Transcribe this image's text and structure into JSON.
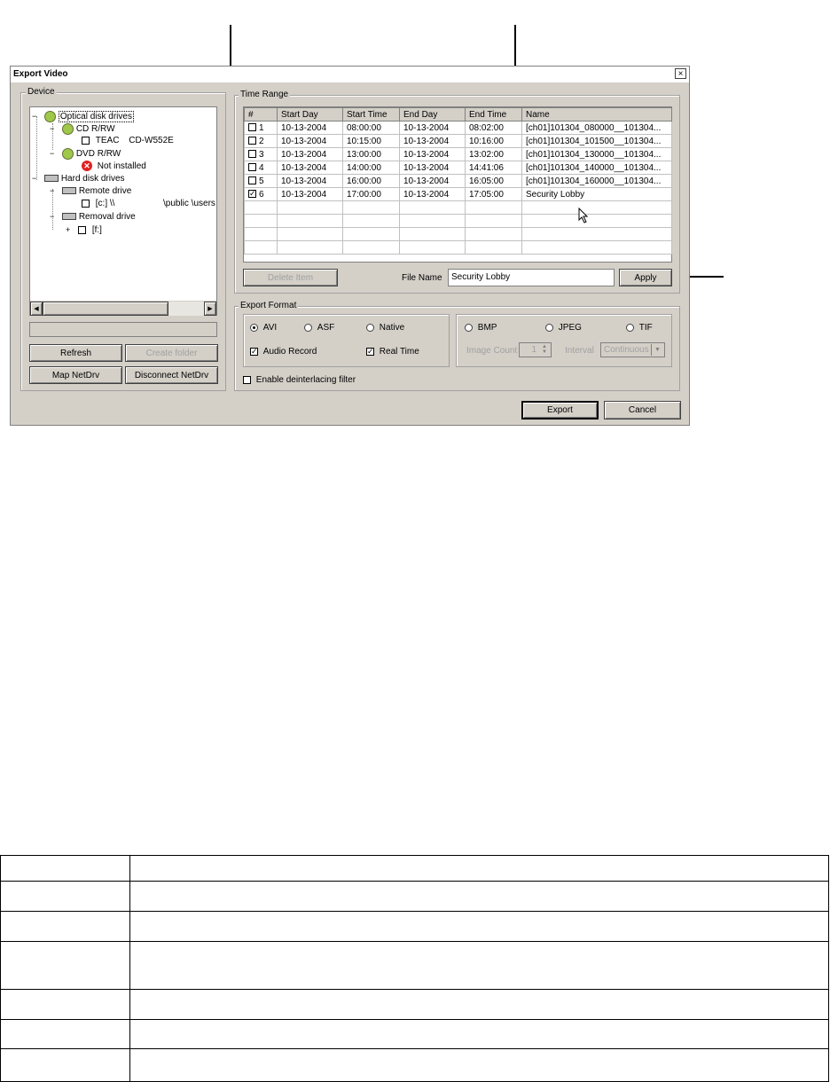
{
  "window": {
    "title": "Export Video",
    "close": "×"
  },
  "device": {
    "group_label": "Device",
    "tree": {
      "optical": "Optical disk drives",
      "cdrw": "CD R/RW",
      "teac": "TEAC",
      "teac_model": "CD-W552E",
      "dvdrw": "DVD R/RW",
      "not_installed": "Not installed",
      "hdd": "Hard disk drives",
      "remote": "Remote drive",
      "remote_path": "[c:] \\\\",
      "remote_path_tail": "\\public \\users",
      "removal": "Removal drive",
      "removal_item": "[f:]"
    },
    "buttons": {
      "refresh": "Refresh",
      "create_folder": "Create folder",
      "map_netdrv": "Map NetDrv",
      "disconnect_netdrv": "Disconnect NetDrv"
    }
  },
  "time_range": {
    "group_label": "Time Range",
    "columns": [
      "#",
      "Start Day",
      "Start Time",
      "End Day",
      "End Time",
      "Name"
    ],
    "rows": [
      {
        "num": "1",
        "checked": false,
        "start_day": "10-13-2004",
        "start_time": "08:00:00",
        "end_day": "10-13-2004",
        "end_time": "08:02:00",
        "name": "[ch01]101304_080000__101304..."
      },
      {
        "num": "2",
        "checked": false,
        "start_day": "10-13-2004",
        "start_time": "10:15:00",
        "end_day": "10-13-2004",
        "end_time": "10:16:00",
        "name": "[ch01]101304_101500__101304..."
      },
      {
        "num": "3",
        "checked": false,
        "start_day": "10-13-2004",
        "start_time": "13:00:00",
        "end_day": "10-13-2004",
        "end_time": "13:02:00",
        "name": "[ch01]101304_130000__101304..."
      },
      {
        "num": "4",
        "checked": false,
        "start_day": "10-13-2004",
        "start_time": "14:00:00",
        "end_day": "10-13-2004",
        "end_time": "14:41:06",
        "name": "[ch01]101304_140000__101304..."
      },
      {
        "num": "5",
        "checked": false,
        "start_day": "10-13-2004",
        "start_time": "16:00:00",
        "end_day": "10-13-2004",
        "end_time": "16:05:00",
        "name": "[ch01]101304_160000__101304..."
      },
      {
        "num": "6",
        "checked": true,
        "start_day": "10-13-2004",
        "start_time": "17:00:00",
        "end_day": "10-13-2004",
        "end_time": "17:05:00",
        "name": "Security Lobby"
      }
    ],
    "delete_item": "Delete Item",
    "file_name_label": "File Name",
    "file_name_value": "Security Lobby",
    "apply": "Apply"
  },
  "export_format": {
    "group_label": "Export Format",
    "avi": "AVI",
    "asf": "ASF",
    "native": "Native",
    "audio_record": "Audio Record",
    "real_time": "Real Time",
    "bmp": "BMP",
    "jpeg": "JPEG",
    "tif": "TIF",
    "image_count_label": "Image Count",
    "image_count_value": "1",
    "interval_label": "Interval",
    "interval_value": "Continuous",
    "deinterlace": "Enable deinterlacing filter"
  },
  "footer": {
    "export": "Export",
    "cancel": "Cancel"
  }
}
